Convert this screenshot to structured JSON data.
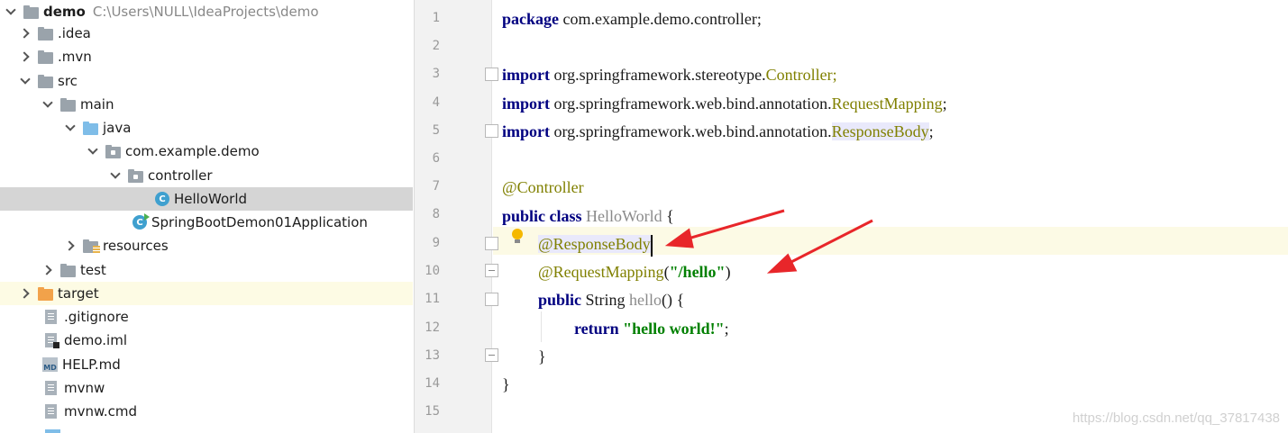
{
  "project": {
    "root_name": "demo",
    "root_path": "C:\\Users\\NULL\\IdeaProjects\\demo",
    "items": [
      {
        "label": ".idea"
      },
      {
        "label": ".mvn"
      },
      {
        "label": "src"
      },
      {
        "label": "main"
      },
      {
        "label": "java"
      },
      {
        "label": "com.example.demo"
      },
      {
        "label": "controller"
      },
      {
        "label": "HelloWorld"
      },
      {
        "label": "SpringBootDemon01Application"
      },
      {
        "label": "resources"
      },
      {
        "label": "test"
      },
      {
        "label": "target"
      },
      {
        "label": ".gitignore"
      },
      {
        "label": "demo.iml"
      },
      {
        "label": "HELP.md"
      },
      {
        "label": "mvnw"
      },
      {
        "label": "mvnw.cmd"
      }
    ],
    "class_icon_letter": "C",
    "md_icon_label": "MD"
  },
  "editor": {
    "line_numbers": [
      "1",
      "2",
      "3",
      "4",
      "5",
      "6",
      "7",
      "8",
      "9",
      "10",
      "11",
      "12",
      "13",
      "14",
      "15"
    ],
    "tokens": {
      "package_kw": "package",
      "package_name": " com.example.demo.controller;",
      "import_kw": "import",
      "import1_pkg": " org.springframework.stereotype.",
      "import1_cls": "Controller",
      "import2_pkg": " org.springframework.web.bind.annotation.",
      "import2_cls": "RequestMapping",
      "import3_pkg": " org.springframework.web.bind.annotation.",
      "import3_cls": "ResponseBody",
      "semicolon": ";",
      "controller_ann": "@Controller",
      "public_kw": "public",
      "class_kw": "class",
      "class_name": "HelloWorld",
      "open_brace": " {",
      "response_body_ann": "@ResponseBody",
      "request_mapping_ann": "@RequestMapping",
      "mapping_open": "(",
      "mapping_value": "\"/hello\"",
      "mapping_close": ")",
      "string_type": " String ",
      "method_name": "hello",
      "method_sig": "() {",
      "return_kw": "return",
      "return_value": "\"hello world!\"",
      "close_brace": "}"
    }
  },
  "watermark": "https://blog.csdn.net/qq_37817438",
  "colors": {
    "arrow": "#e8262a",
    "keyword": "#000080",
    "annotation": "#808000",
    "string": "#008000",
    "selected_row": "#d5d5d5"
  }
}
